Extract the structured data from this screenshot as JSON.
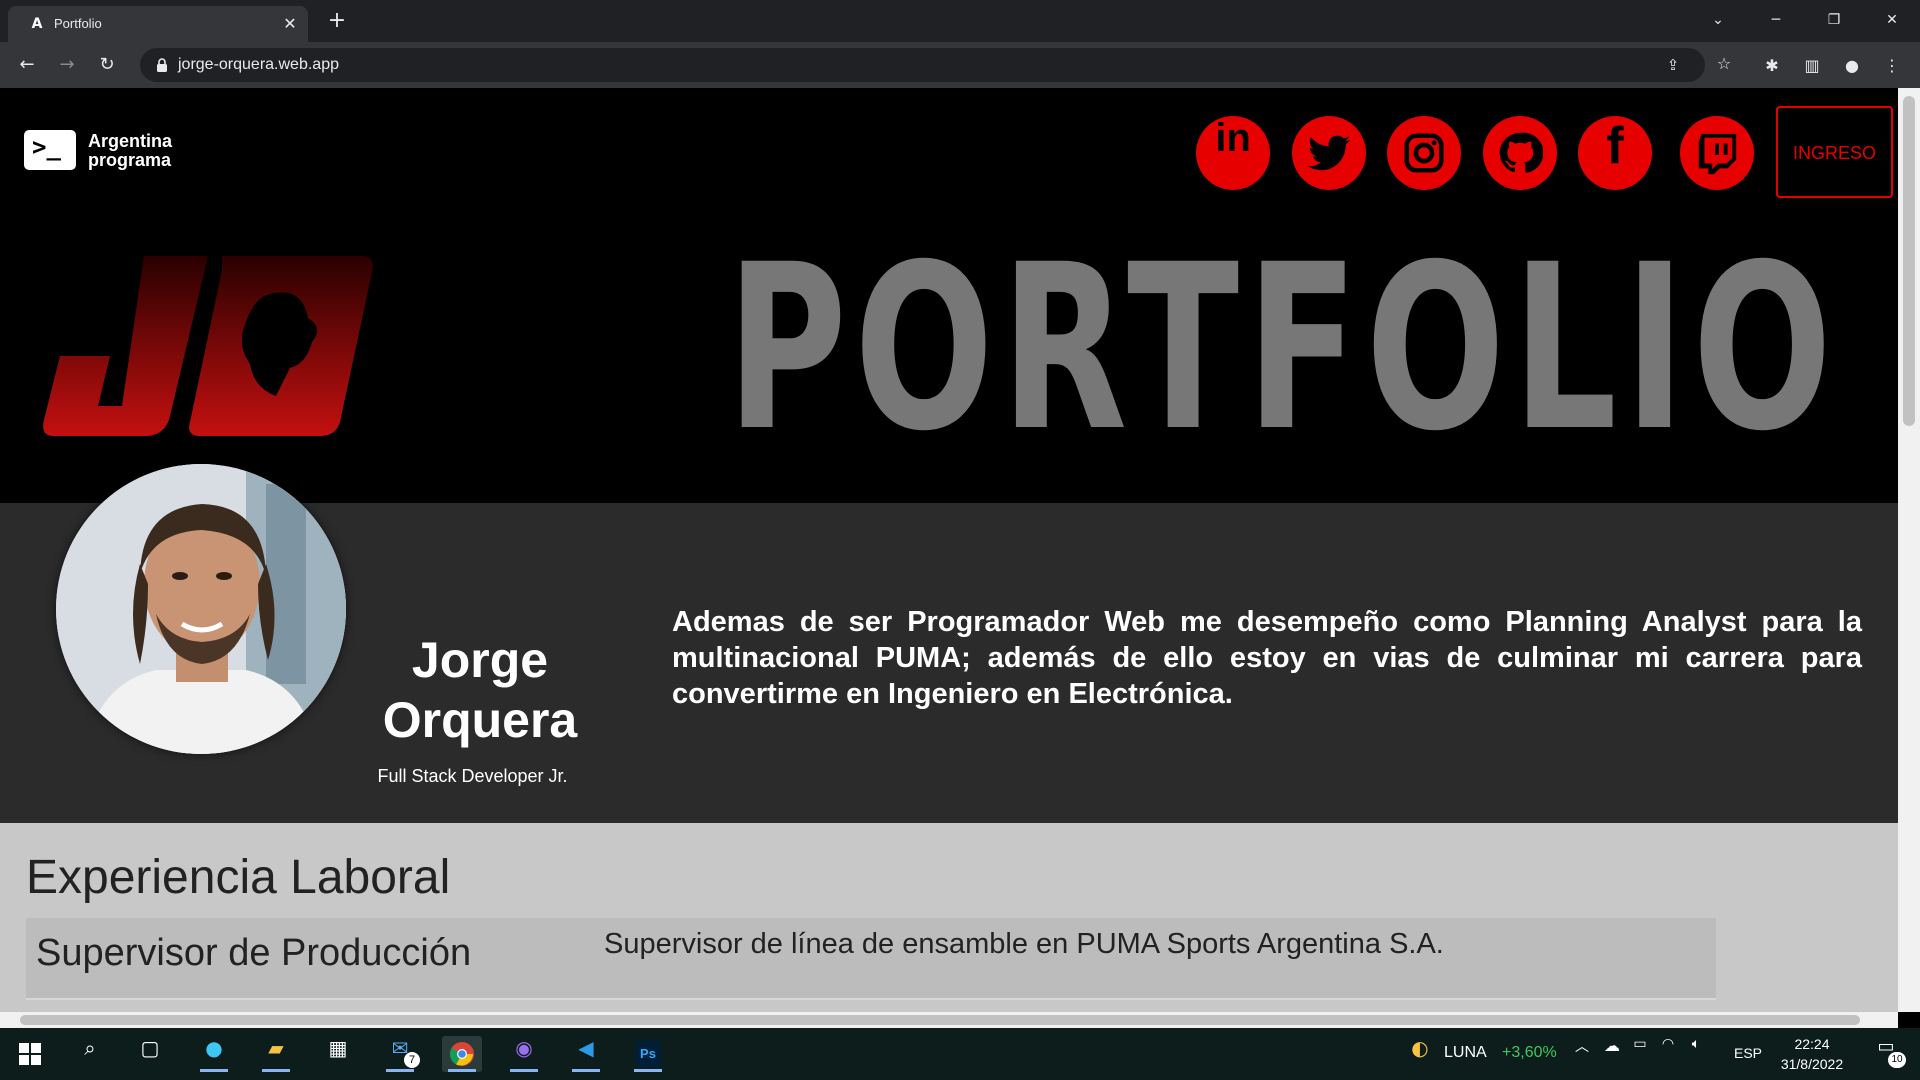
{
  "browser": {
    "tab_title": "Portfolio",
    "tab_favicon": "A",
    "url": "jorge-orquera.web.app",
    "new_tab_glyph": "+",
    "close_glyph": "✕"
  },
  "header": {
    "logo_line1": "Argentina",
    "logo_line2": "programa",
    "social": [
      {
        "name": "linkedin",
        "label": "in"
      },
      {
        "name": "twitter",
        "label": ""
      },
      {
        "name": "instagram",
        "label": ""
      },
      {
        "name": "github",
        "label": ""
      },
      {
        "name": "facebook",
        "label": "f"
      },
      {
        "name": "twitch",
        "label": ""
      }
    ],
    "login_label": "INGRESO"
  },
  "hero": {
    "title": "PORTFOLIO",
    "logo_letters": "JO"
  },
  "about": {
    "first_name": "Jorge",
    "last_name": "Orquera",
    "role": "Full Stack Developer Jr.",
    "bio": "Ademas de ser Programador Web me desempeño como Planning Analyst para la multinacional PUMA; además de ello estoy en vias de culminar mi carrera para convertirme en Ingeniero en Electrónica."
  },
  "experience": {
    "title": "Experiencia Laboral",
    "items": [
      {
        "role": "Supervisor de Producción",
        "description": "Supervisor de línea de ensamble en PUMA Sports Argentina S.A."
      }
    ]
  },
  "taskbar": {
    "ticker_name": "LUNA",
    "ticker_change": "+3,60%",
    "language": "ESP",
    "time": "22:24",
    "date": "31/8/2022",
    "mail_badge": "7",
    "notifications_badge": "10"
  },
  "colors": {
    "accent_red": "#e60000",
    "page_bg": "#000000",
    "about_bg": "#2b2b2c",
    "experience_bg": "#c8c8c8"
  }
}
